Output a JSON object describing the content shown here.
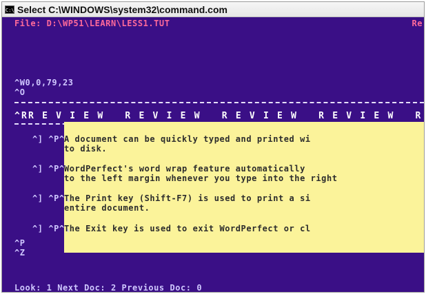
{
  "window": {
    "title": "Select C:\\WINDOWS\\system32\\command.com",
    "icon": "terminal-icon"
  },
  "console": {
    "file_line": "File: D:\\WP51\\LEARN\\LESS1.TUT",
    "file_right": "Re",
    "codes": [
      "^W0,0,79,23",
      "^O"
    ],
    "review_banner": "^RR E V I E W   R E V I E W   R E V I E W   R E V I E W   R E",
    "items": [
      {
        "marker": "^] ^P^\\",
        "line1": "A document can be quickly typed and printed wi",
        "line2": "to disk."
      },
      {
        "marker": "^] ^P^\\",
        "line1": "WordPerfect's word wrap feature automatically",
        "line2": "to the left margin whenever you type into the right"
      },
      {
        "marker": "^] ^P^\\",
        "line1": "The Print key (Shift-F7) is used to print a si",
        "line2": "entire document."
      },
      {
        "marker": "^] ^P^\\",
        "line1": "The Exit key is used to exit WordPerfect or cl",
        "line2": ""
      }
    ],
    "tail_codes": [
      "^P",
      "^Z"
    ],
    "footer": "Look: 1 Next Doc: 2 Previous Doc: 0"
  },
  "colors": {
    "console_bg": "#3a0f86",
    "highlight_bg": "#fbf39a",
    "file_text": "#ff6a9a"
  }
}
